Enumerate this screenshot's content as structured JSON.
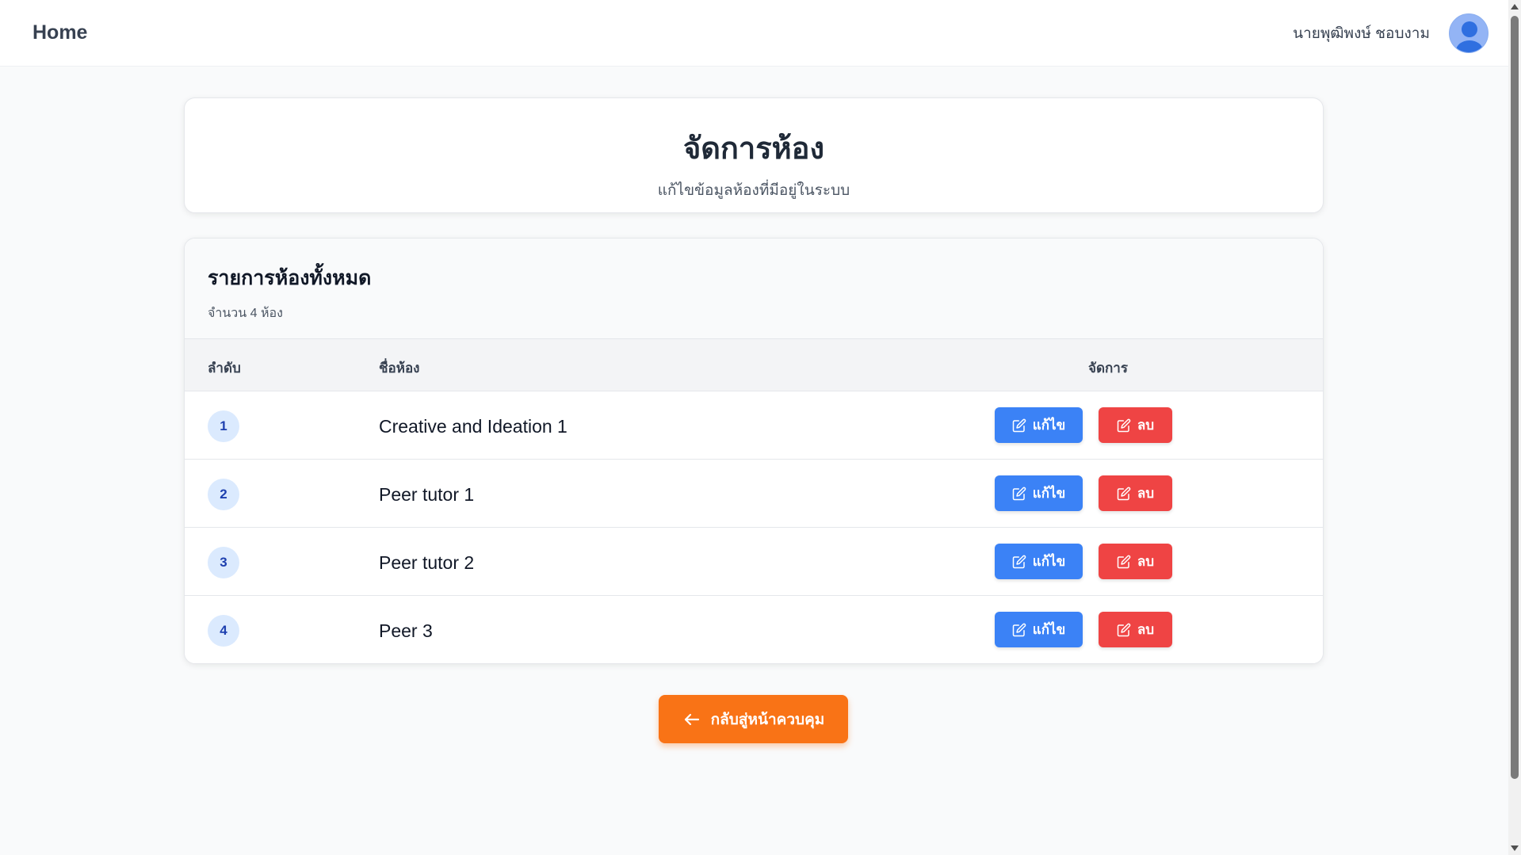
{
  "header": {
    "home_label": "Home",
    "user_name": "นายพุฒิพงษ์ ชอบงาม"
  },
  "page": {
    "title": "จัดการห้อง",
    "subtitle": "แก้ไขข้อมูลห้องที่มีอยู่ในระบบ"
  },
  "list": {
    "title": "รายการห้องทั้งหมด",
    "count_text": "จำนวน 4 ห้อง",
    "columns": {
      "no": "ลำดับ",
      "name": "ชื่อห้อง",
      "manage": "จัดการ"
    },
    "rows": [
      {
        "no": "1",
        "name": "Creative and Ideation 1",
        "edit_label": "แก้ไข",
        "delete_label": "ลบ"
      },
      {
        "no": "2",
        "name": "Peer tutor 1",
        "edit_label": "แก้ไข",
        "delete_label": "ลบ"
      },
      {
        "no": "3",
        "name": "Peer tutor 2",
        "edit_label": "แก้ไข",
        "delete_label": "ลบ"
      },
      {
        "no": "4",
        "name": "Peer 3",
        "edit_label": "แก้ไข",
        "delete_label": "ลบ"
      }
    ]
  },
  "footer": {
    "back_label": "กลับสู่หน้าควบคุม"
  },
  "icons": {
    "avatar": "user-avatar-icon",
    "edit": "pencil-square-icon",
    "delete": "pencil-square-icon",
    "back": "arrow-left-icon"
  },
  "colors": {
    "edit_button": "#3b82f6",
    "delete_button": "#ef4444",
    "back_button": "#f97316",
    "badge_bg": "#dbeafe",
    "badge_text": "#1e40af"
  }
}
